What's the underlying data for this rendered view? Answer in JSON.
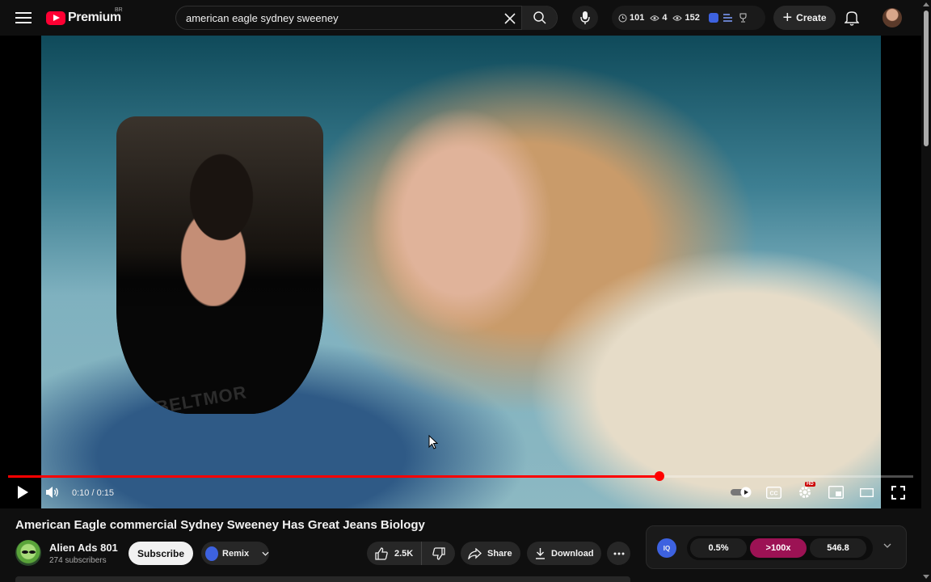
{
  "header": {
    "logo_text": "Premium",
    "country_code": "BR",
    "search_value": "american eagle sydney sweeney",
    "stats": {
      "watch_count": "101",
      "views_label_a": "4",
      "views_label_b": "152"
    },
    "create_label": "Create"
  },
  "player": {
    "time_display": "0:10 / 0:15",
    "progress_fraction": 0.72,
    "pip_shirt_text": "BELTMOR",
    "hd_badge": "HD"
  },
  "video": {
    "title": "American Eagle commercial Sydney Sweeney Has Great Jeans Biology"
  },
  "channel": {
    "name": "Alien Ads 801",
    "subscribers": "274 subscribers",
    "subscribe_label": "Subscribe",
    "remix_label": "Remix"
  },
  "actions": {
    "like_count": "2.5K",
    "share_label": "Share",
    "download_label": "Download"
  },
  "iq_panel": {
    "logo_text": "IQ",
    "metric_1": "0.5%",
    "metric_2": ">100x",
    "metric_3": "546.8",
    "accent_color": "#9c1254"
  },
  "colors": {
    "brand_red": "#ff0033",
    "progress_red": "#ff0000",
    "iq_blue": "#3d62e0"
  }
}
